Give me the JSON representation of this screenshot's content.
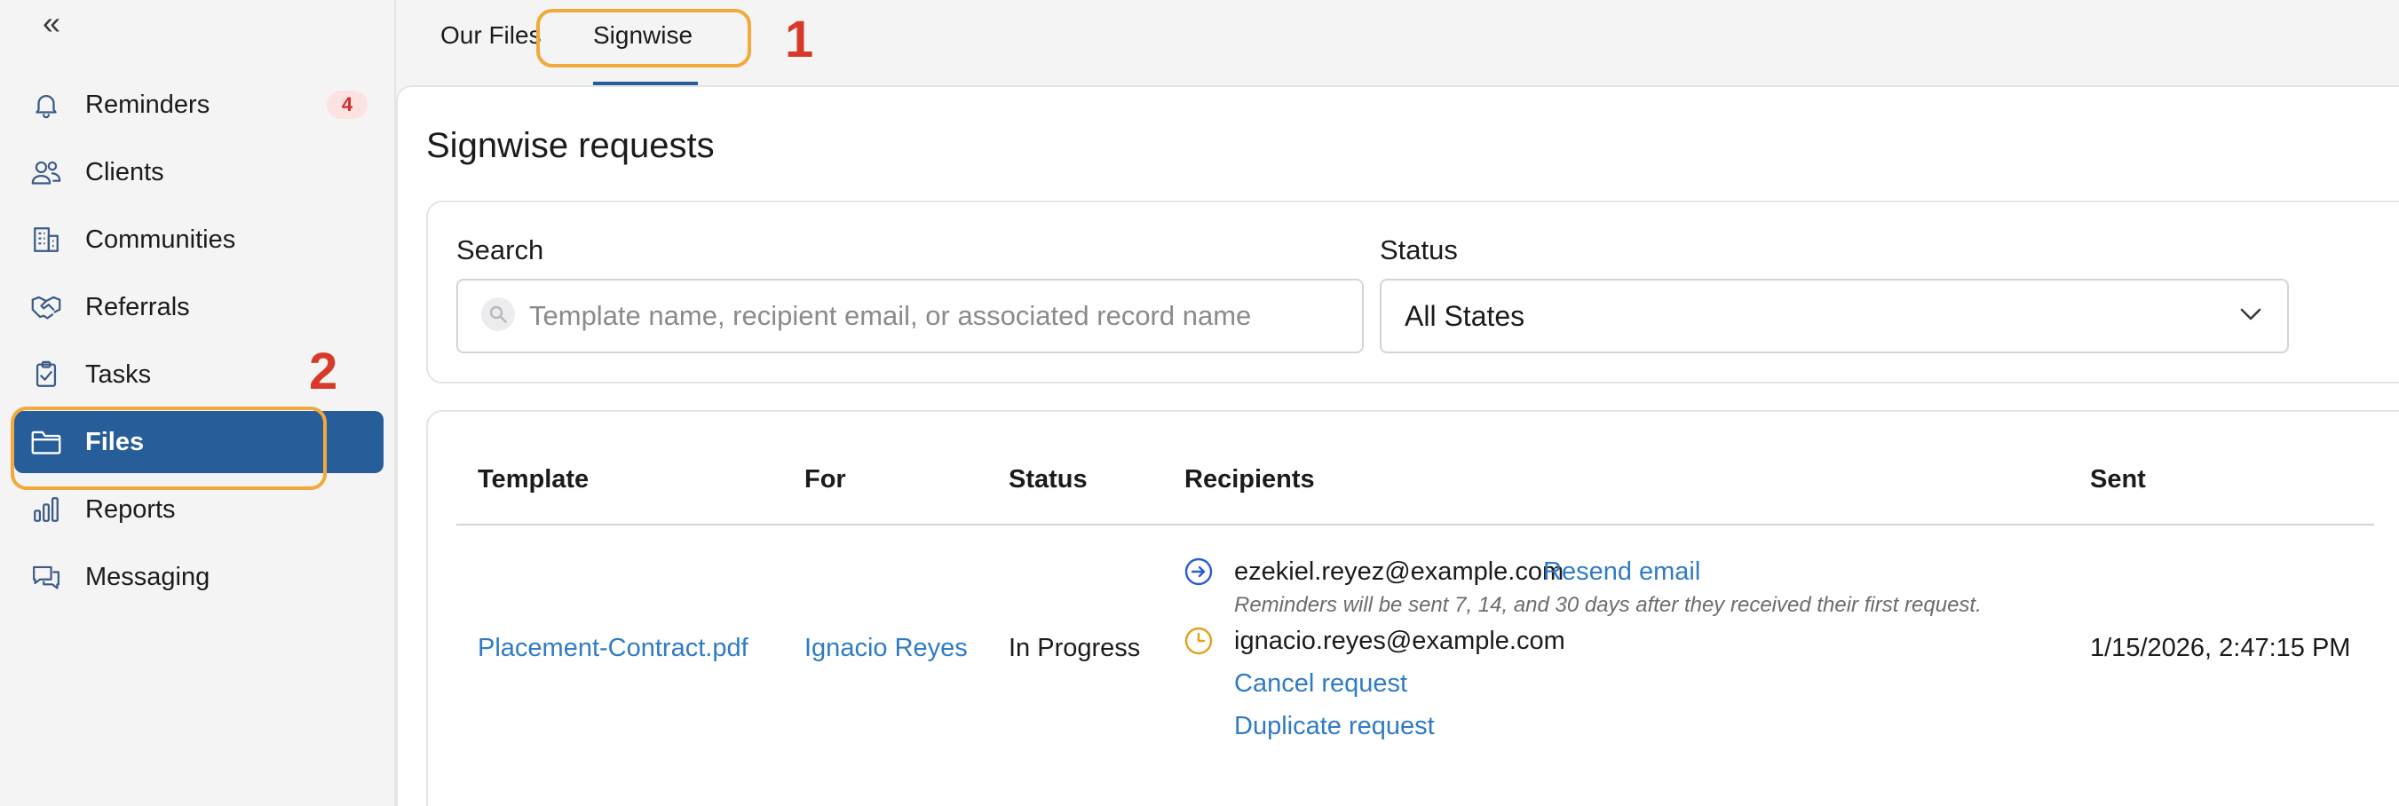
{
  "sidebar": {
    "collapse_glyph": "«",
    "items": [
      {
        "label": "Reminders",
        "icon": "bell-icon",
        "badge": "4"
      },
      {
        "label": "Clients",
        "icon": "users-icon"
      },
      {
        "label": "Communities",
        "icon": "building-icon"
      },
      {
        "label": "Referrals",
        "icon": "handshake-icon"
      },
      {
        "label": "Tasks",
        "icon": "clipboard-icon"
      },
      {
        "label": "Files",
        "icon": "folder-icon",
        "active": true
      },
      {
        "label": "Reports",
        "icon": "bar-chart-icon"
      },
      {
        "label": "Messaging",
        "icon": "chat-icon"
      }
    ]
  },
  "tabs": [
    {
      "label": "Our Files"
    },
    {
      "label": "Signwise",
      "active": true
    }
  ],
  "annotations": {
    "one": "1",
    "two": "2"
  },
  "main": {
    "title": "Signwise requests",
    "search": {
      "label": "Search",
      "placeholder": "Template name, recipient email, or associated record name"
    },
    "status_filter": {
      "label": "Status",
      "value": "All States"
    },
    "table": {
      "headers": [
        "Template",
        "For",
        "Status",
        "Recipients",
        "Sent"
      ],
      "rows": [
        {
          "template": "Placement-Contract.pdf",
          "for": "Ignacio Reyes",
          "status": "In Progress",
          "recipients": [
            {
              "email": "ezekiel.reyez@example.com",
              "action": "Resend email",
              "note": "Reminders will be sent 7, 14, and 30 days after they received their first request."
            },
            {
              "email": "ignacio.reyes@example.com",
              "actions": [
                "Cancel request",
                "Duplicate request"
              ]
            }
          ],
          "sent": "1/15/2026, 2:47:15 PM"
        }
      ]
    }
  },
  "colors": {
    "accent": "#275d99",
    "link": "#2f7bc4",
    "annotation_box": "#f0a93a",
    "annotation_number": "#d73a2a",
    "badge_text": "#d32f2f"
  }
}
